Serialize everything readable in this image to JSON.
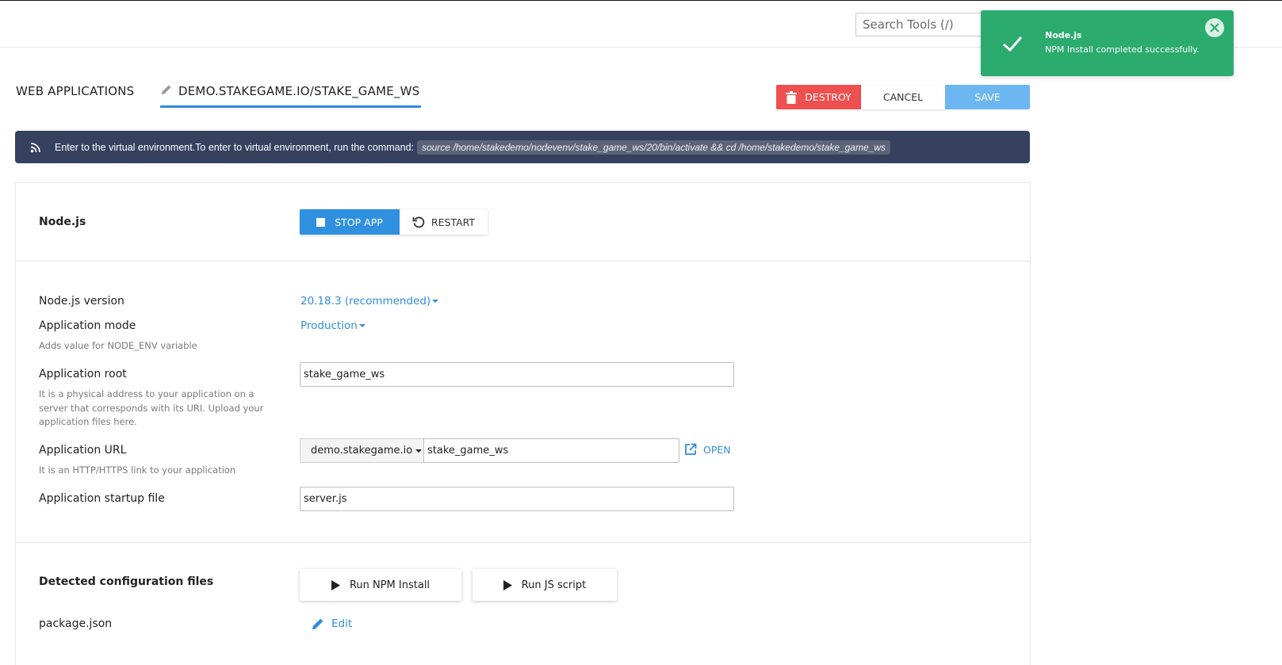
{
  "header": {
    "search_placeholder": "Search Tools (/)"
  },
  "toast": {
    "title": "Node.js",
    "message": "NPM Install completed successfully."
  },
  "breadcrumb": {
    "apps_label": "WEB APPLICATIONS",
    "current_label": "DEMO.STAKEGAME.IO/STAKE_GAME_WS"
  },
  "actions": {
    "destroy_label": "DESTROY",
    "cancel_label": "CANCEL",
    "save_label": "SAVE"
  },
  "info_banner": {
    "message": "Enter to the virtual environment.To enter to virtual environment, run the command:",
    "command": "source /home/stakedemo/nodevenv/stake_game_ws/20/bin/activate && cd /home/stakedemo/stake_game_ws"
  },
  "app_section": {
    "title": "Node.js",
    "stop_label": "STOP APP",
    "restart_label": "RESTART"
  },
  "form": {
    "version_label": "Node.js version",
    "version_value": "20.18.3 (recommended)",
    "mode_label": "Application mode",
    "mode_value": "Production",
    "mode_hint": "Adds value for NODE_ENV variable",
    "root_label": "Application root",
    "root_value": "stake_game_ws",
    "root_hint": "It is a physical address to your application on a server that corresponds with its URI. Upload your application files here.",
    "url_label": "Application URL",
    "url_domain": "demo.stakegame.io",
    "url_path": "stake_game_ws",
    "url_hint": "It is an HTTP/HTTPS link to your application",
    "open_label": "OPEN",
    "startup_label": "Application startup file",
    "startup_value": "server.js"
  },
  "config": {
    "title": "Detected configuration files",
    "npm_label": "Run NPM Install",
    "js_label": "Run JS script",
    "file_name": "package.json",
    "edit_label": "Edit"
  },
  "colors": {
    "accent": "#2f8ddc",
    "toast_bg": "#2bab6e",
    "banner_bg": "#36405f",
    "destroy_bg": "#ee5050",
    "save_bg": "#6cb6f2"
  }
}
